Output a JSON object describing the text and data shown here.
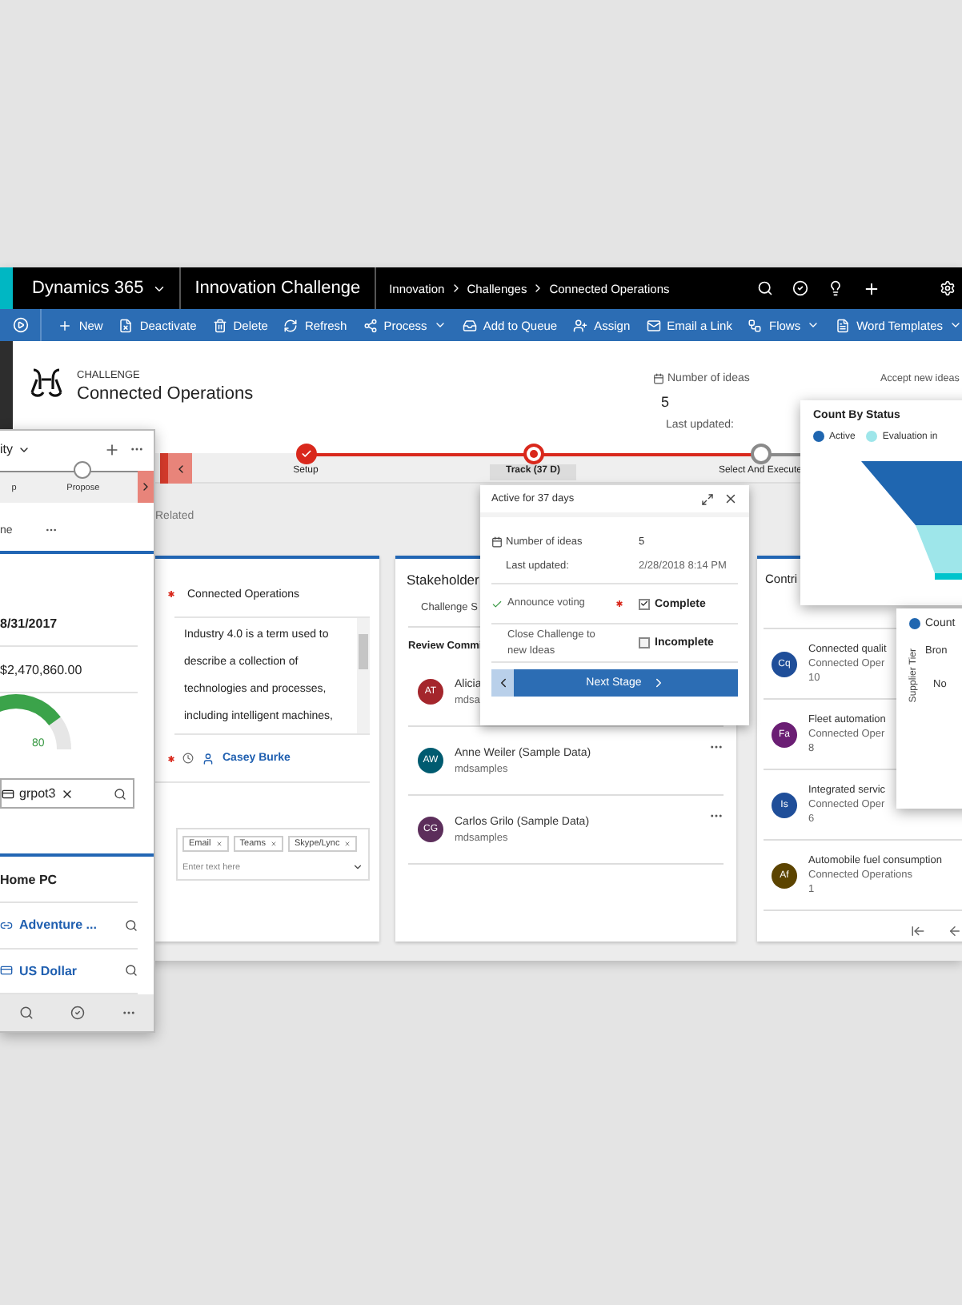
{
  "nav": {
    "product": "Dynamics 365",
    "app": "Innovation Challenge",
    "breadcrumb": [
      "Innovation",
      "Challenges",
      "Connected Operations"
    ]
  },
  "commands": [
    {
      "label": "New",
      "dropdown": false
    },
    {
      "label": "Deactivate",
      "dropdown": false
    },
    {
      "label": "Delete",
      "dropdown": false
    },
    {
      "label": "Refresh",
      "dropdown": false
    },
    {
      "label": "Process",
      "dropdown": true
    },
    {
      "label": "Add to Queue",
      "dropdown": false
    },
    {
      "label": "Assign",
      "dropdown": false
    },
    {
      "label": "Email a Link",
      "dropdown": false
    },
    {
      "label": "Flows",
      "dropdown": true
    },
    {
      "label": "Word Templates",
      "dropdown": true
    }
  ],
  "header": {
    "entity": "CHALLENGE",
    "title": "Connected Operations",
    "ideas_label": "Number of ideas",
    "ideas_value": "5",
    "updated_label": "Last updated:",
    "accept_label": "Accept new ideas"
  },
  "process": {
    "stages": [
      {
        "label": "Setup",
        "completed": true,
        "selected": false
      },
      {
        "label": "Track  (37 D)",
        "completed": false,
        "selected": true
      },
      {
        "label": "Select And Execute",
        "completed": false,
        "selected": false
      }
    ]
  },
  "tabs": [
    {
      "label": "Related",
      "selected": false
    }
  ],
  "details": {
    "name": "Connected Operations",
    "description": "Industry 4.0 is a term used to describe a collection of technologies and processes, including intelligent machines,",
    "owner": "Casey Burke",
    "channels": [
      "Email",
      "Teams",
      "Skype/Lync"
    ],
    "channels_placeholder": "Enter text here"
  },
  "stakeholders": {
    "title": "Stakeholder",
    "subtitle": "Challenge S",
    "section": "Review Commi",
    "people": [
      {
        "initials": "AT",
        "name": "Alicia",
        "email": "mdsa",
        "color": "#a4262c"
      },
      {
        "initials": "AW",
        "name": "Anne Weiler (Sample Data)",
        "email": "mdsamples",
        "color": "#005b70"
      },
      {
        "initials": "CG",
        "name": "Carlos Grilo (Sample Data)",
        "email": "mdsamples",
        "color": "#5c2e5b"
      }
    ]
  },
  "contributions": {
    "title": "Contri",
    "items": [
      {
        "initials": "Cq",
        "title": "Connected qualit",
        "subtitle": "Connected Oper",
        "count": "10",
        "color": "#1f4e99"
      },
      {
        "initials": "Fa",
        "title": "Fleet automation",
        "subtitle": "Connected Oper",
        "count": "8",
        "color": "#6b1e74"
      },
      {
        "initials": "Is",
        "title": "Integrated servic",
        "subtitle": "Connected Oper",
        "count": "6",
        "color": "#1f4e99"
      },
      {
        "initials": "Af",
        "title": "Automobile fuel consumption",
        "subtitle": "Connected Operations",
        "count": "1",
        "color": "#5c4400"
      }
    ]
  },
  "stage_popup": {
    "title": "Active for 37 days",
    "ideas_label": "Number of ideas",
    "ideas_value": "5",
    "updated_label": "Last updated:",
    "updated_value": "2/28/2018 8:14 PM",
    "steps": [
      {
        "label": "Announce voting",
        "done": true,
        "required": true,
        "checked": true,
        "status": "Complete"
      },
      {
        "label": "Close Challenge to new Ideas",
        "done": false,
        "required": false,
        "checked": false,
        "status": "Incomplete"
      }
    ],
    "button": "Next Stage"
  },
  "status_chart": {
    "title": "Count By Status",
    "legend": [
      {
        "label": "Active",
        "color": "#1f66b0"
      },
      {
        "label": "Evaluation in",
        "color": "#9ee6ea"
      }
    ]
  },
  "tier_chart": {
    "legend": "Count",
    "axis_title": "Supplier Tier",
    "categories": [
      "Bron",
      "No"
    ]
  },
  "mobile": {
    "header": "ity",
    "stages": [
      {
        "label": "p",
        "selected": false
      },
      {
        "label": "Propose",
        "selected": false
      }
    ],
    "tab": "ne",
    "date": "8/31/2017",
    "amount": "$2,470,860.00",
    "gauge": {
      "level": 0.8,
      "reading": "80"
    },
    "lookup": "grpot3",
    "machine": "Home PC",
    "account": "Adventure ...",
    "currency": "US Dollar"
  }
}
